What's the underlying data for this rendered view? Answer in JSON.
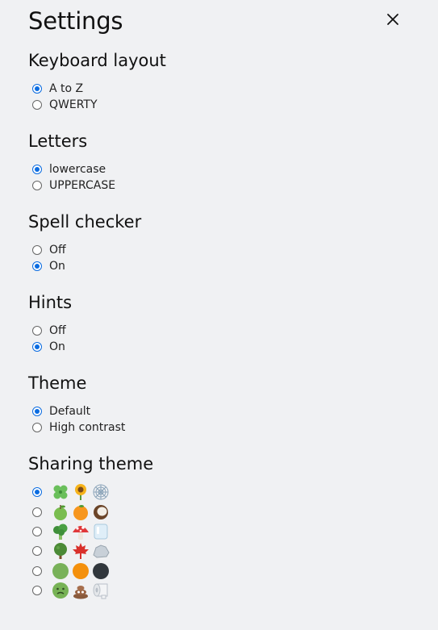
{
  "title": "Settings",
  "sections": [
    {
      "key": "keyboard",
      "title": "Keyboard layout",
      "options": [
        {
          "label": "A to Z",
          "checked": true
        },
        {
          "label": "QWERTY",
          "checked": false
        }
      ]
    },
    {
      "key": "letters",
      "title": "Letters",
      "options": [
        {
          "label": "lowercase",
          "checked": true
        },
        {
          "label": "UPPERCASE",
          "checked": false
        }
      ]
    },
    {
      "key": "spell",
      "title": "Spell checker",
      "options": [
        {
          "label": "Off",
          "checked": false
        },
        {
          "label": "On",
          "checked": true
        }
      ]
    },
    {
      "key": "hints",
      "title": "Hints",
      "options": [
        {
          "label": "Off",
          "checked": false
        },
        {
          "label": "On",
          "checked": true
        }
      ]
    },
    {
      "key": "theme",
      "title": "Theme",
      "options": [
        {
          "label": "Default",
          "checked": true
        },
        {
          "label": "High contrast",
          "checked": false
        }
      ]
    }
  ],
  "sharing": {
    "title": "Sharing theme",
    "rows": [
      {
        "checked": true,
        "icons": [
          "clover-icon",
          "sunflower-icon",
          "spiderweb-icon"
        ]
      },
      {
        "checked": false,
        "icons": [
          "green-apple-icon",
          "orange-icon",
          "coconut-icon"
        ]
      },
      {
        "checked": false,
        "icons": [
          "broccoli-icon",
          "mushroom-icon",
          "ice-icon"
        ]
      },
      {
        "checked": false,
        "icons": [
          "tree-icon",
          "maple-leaf-icon",
          "rock-icon"
        ]
      },
      {
        "checked": false,
        "icons": [
          "green-circle-icon",
          "orange-circle-icon",
          "black-circle-icon"
        ]
      },
      {
        "checked": false,
        "icons": [
          "nauseated-face-icon",
          "poop-icon",
          "toilet-paper-icon"
        ]
      }
    ]
  },
  "colors": {
    "accent": "#0b6ce1",
    "background": "#f0f1f3"
  }
}
